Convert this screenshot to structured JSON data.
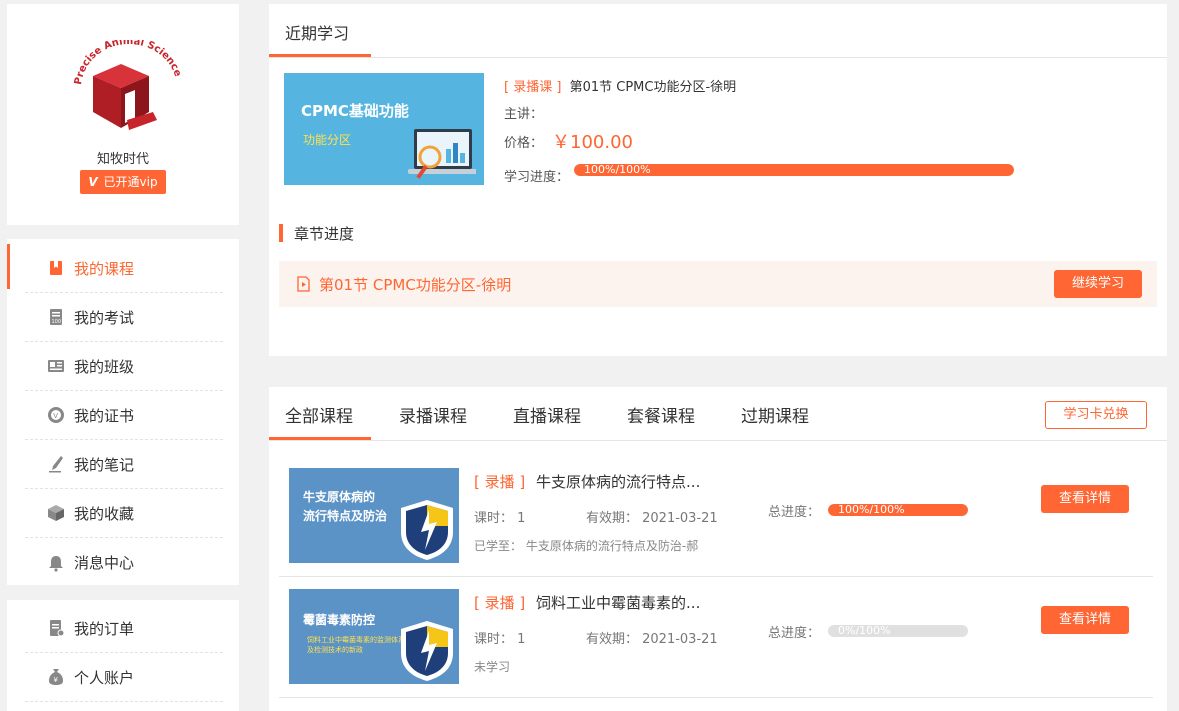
{
  "sidebar": {
    "profile": {
      "logo_text": "Precise Animal Science",
      "username": "知牧时代",
      "vip_icon": "V",
      "vip_label": "已开通vip"
    },
    "menu_primary": [
      {
        "label": "我的课程",
        "icon": "course-bookmark-icon",
        "active": true
      },
      {
        "label": "我的考试",
        "icon": "exam-icon",
        "active": false
      },
      {
        "label": "我的班级",
        "icon": "class-icon",
        "active": false
      },
      {
        "label": "我的证书",
        "icon": "certificate-icon",
        "active": false
      },
      {
        "label": "我的笔记",
        "icon": "note-pen-icon",
        "active": false
      },
      {
        "label": "我的收藏",
        "icon": "favorite-box-icon",
        "active": false
      },
      {
        "label": "消息中心",
        "icon": "bell-icon",
        "active": false
      }
    ],
    "menu_secondary": [
      {
        "label": "我的订单",
        "icon": "order-icon"
      },
      {
        "label": "个人账户",
        "icon": "money-bag-icon"
      }
    ]
  },
  "recent": {
    "title": "近期学习",
    "thumb_title": "CPMC基础功能",
    "thumb_sub": "功能分区",
    "tag": "[ 录播课 ]",
    "course_name": "第01节 CPMC功能分区-徐明",
    "teacher_label": "主讲：",
    "price_label": "价格：",
    "price": "￥100.00",
    "progress_label": "学习进度：",
    "progress_text": "100%/100%",
    "progress_value": 100,
    "chapter_section_title": "章节进度",
    "chapter_name": "第01节 CPMC功能分区-徐明",
    "continue_label": "继续学习"
  },
  "course_list": {
    "tabs": [
      "全部课程",
      "录播课程",
      "直播课程",
      "套餐课程",
      "过期课程"
    ],
    "active_tab": 0,
    "redeem_label": "学习卡兑换",
    "items": [
      {
        "thumb_title": "牛支原体病的\n流行特点及防治",
        "thumb_sub": "",
        "tag": "[ 录播 ]",
        "name": "牛支原体病的流行特点...",
        "hours": "课时： 1",
        "expiry": "有效期： 2021-03-21",
        "status": "已学至： 牛支原体病的流行特点及防治-郝",
        "progress_label": "总进度：",
        "progress_text": "100%/100%",
        "progress_value": 100,
        "detail_label": "查看详情"
      },
      {
        "thumb_title": "霉菌毒素防控",
        "thumb_sub": "饲料工业中霉菌毒素的监测体系\n及检测技术的新政",
        "tag": "[ 录播 ]",
        "name": "饲料工业中霉菌毒素的...",
        "hours": "课时： 1",
        "expiry": "有效期： 2021-03-21",
        "status": "未学习",
        "progress_label": "总进度：",
        "progress_text": "0%/100%",
        "progress_value": 0,
        "detail_label": "查看详情"
      }
    ]
  },
  "colors": {
    "accent": "#ff6633",
    "logo_red": "#c8242b",
    "thumb_blue": "#55b5e0",
    "course_thumb_blue": "#5c93c7"
  }
}
